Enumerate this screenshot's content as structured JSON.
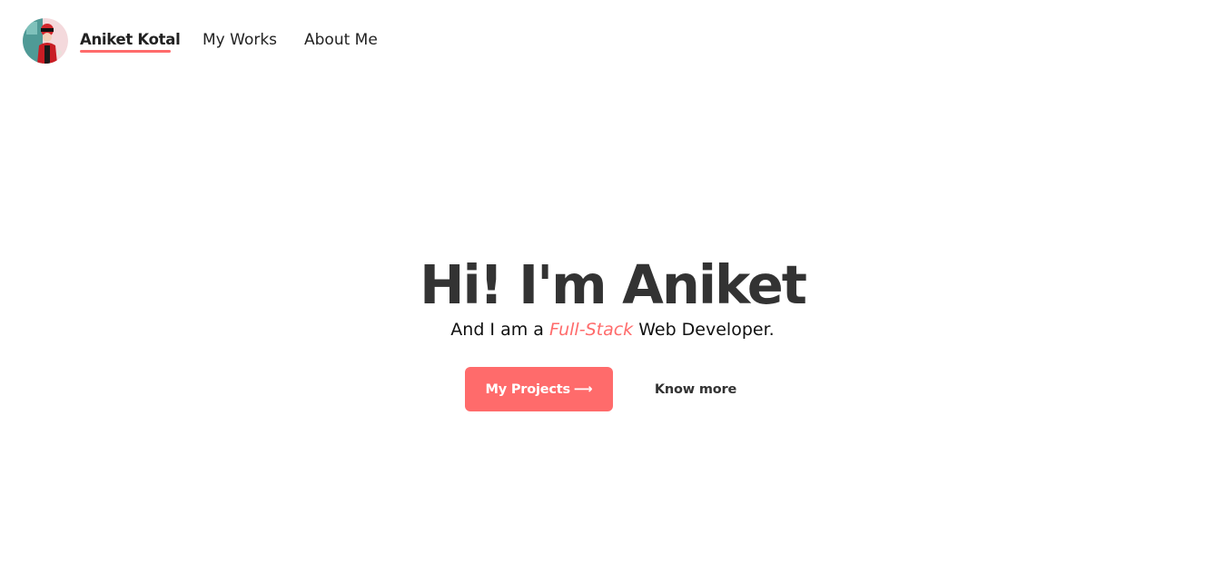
{
  "colors": {
    "accent": "#ff6b6b",
    "text_dark": "#333333",
    "background": "#ffffff"
  },
  "nav": {
    "avatar_icon": "profile-avatar",
    "home_label": "Aniket Kotal",
    "works_label": "My Works",
    "about_label": "About Me"
  },
  "hero": {
    "title": "Hi! I'm Aniket",
    "subtitle_prefix": "And I am a ",
    "subtitle_highlight": "Full-Stack",
    "subtitle_suffix": " Web Developer.",
    "primary_button_label": "My Projects",
    "primary_button_icon": "arrow-right-icon",
    "primary_button_arrow": "⟶",
    "secondary_button_label": "Know more"
  }
}
